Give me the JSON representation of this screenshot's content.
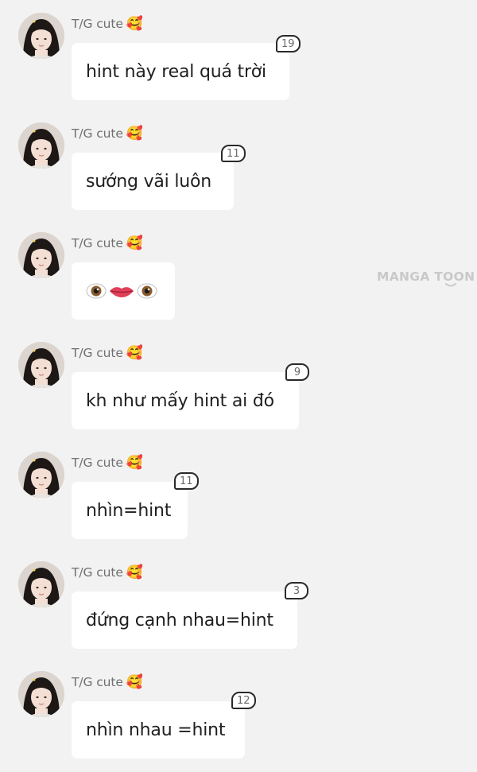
{
  "watermark": {
    "text": "MANGA TOON"
  },
  "messages": [
    {
      "sender": "T/G cute",
      "sender_emoji": "🥰",
      "text": "hint này real quá trời",
      "like_count": "19"
    },
    {
      "sender": "T/G cute",
      "sender_emoji": "🥰",
      "text": "sướng vãi luôn",
      "like_count": "11"
    },
    {
      "sender": "T/G cute",
      "sender_emoji": "🥰",
      "text": "👁️👄👁️",
      "like_count": ""
    },
    {
      "sender": "T/G cute",
      "sender_emoji": "🥰",
      "text": "kh như mấy hint ai đó",
      "like_count": "9"
    },
    {
      "sender": "T/G cute",
      "sender_emoji": "🥰",
      "text": "nhìn=hint",
      "like_count": "11"
    },
    {
      "sender": "T/G cute",
      "sender_emoji": "🥰",
      "text": "đứng cạnh nhau=hint",
      "like_count": "3"
    },
    {
      "sender": "T/G cute",
      "sender_emoji": "🥰",
      "text": "nhìn nhau =hint",
      "like_count": "12"
    }
  ],
  "colors": {
    "background": "#f2f2f2",
    "bubble": "#ffffff",
    "badge_border": "#2a2a2a",
    "watermark": "#c9c9c9"
  },
  "icons": {
    "avatar": "user-photo-avatar",
    "sender_emoji": "smiling-face-with-hearts-icon"
  }
}
